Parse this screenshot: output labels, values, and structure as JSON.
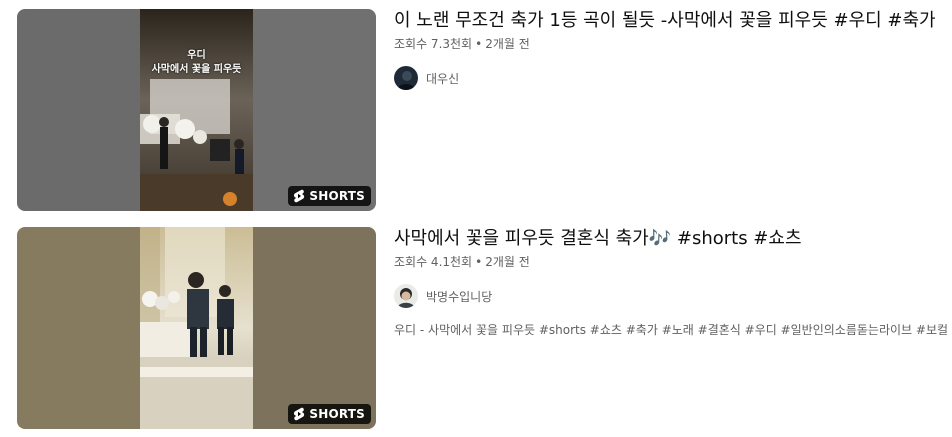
{
  "results": [
    {
      "title": "이 노랜 무조건 축가 1등 곡이 될듯 -사막에서 꽃을 피우듯 #우디 #축가",
      "views": "조회수 7.3천회",
      "age": "2개월 전",
      "channel": "대우신",
      "badge": "SHORTS",
      "overlay_line1": "우디",
      "overlay_line2": "사막에서 꽃을 피우듯"
    },
    {
      "title": "사막에서 꽃을 피우듯 결혼식 축가🎶 #shorts #쇼츠",
      "views": "조회수 4.1천회",
      "age": "2개월 전",
      "channel": "박명수입니당",
      "badge": "SHORTS",
      "description": "우디 - 사막에서 꽃을 피우듯 #shorts #쇼츠 #축가 #노래 #결혼식 #우디 #일반인의소름돋는라이브 #보컬 #"
    }
  ],
  "colors": {
    "badge_bg": "#000000",
    "meta_text": "#606060",
    "thumb1_side": "#6e6e6e",
    "thumb2_side": "#857a5f"
  }
}
